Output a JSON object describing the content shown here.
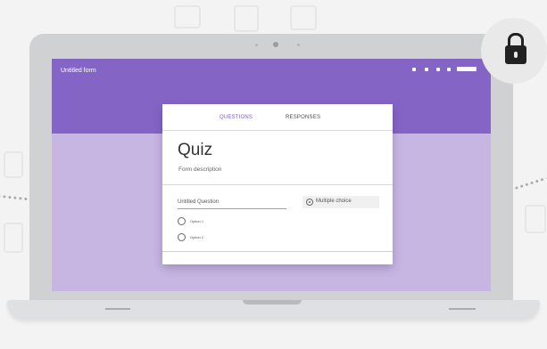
{
  "header": {
    "title": "Untitled form"
  },
  "tabs": [
    {
      "label": "QUESTIONS"
    },
    {
      "label": "RESPONSES"
    }
  ],
  "form": {
    "title": "Quiz",
    "description": "Form description"
  },
  "question": {
    "title": "Untitled Question",
    "type": "Multiple choice",
    "options": [
      {
        "label": "Option 1"
      },
      {
        "label": "Option 2"
      }
    ]
  },
  "icons": {
    "lock": "lock-icon",
    "more": "more-dots-icon"
  },
  "colors": {
    "header": "#8465c6",
    "screen_bg": "#c7b6e2",
    "accent": "#7b5cc4",
    "lock": "#222222"
  }
}
